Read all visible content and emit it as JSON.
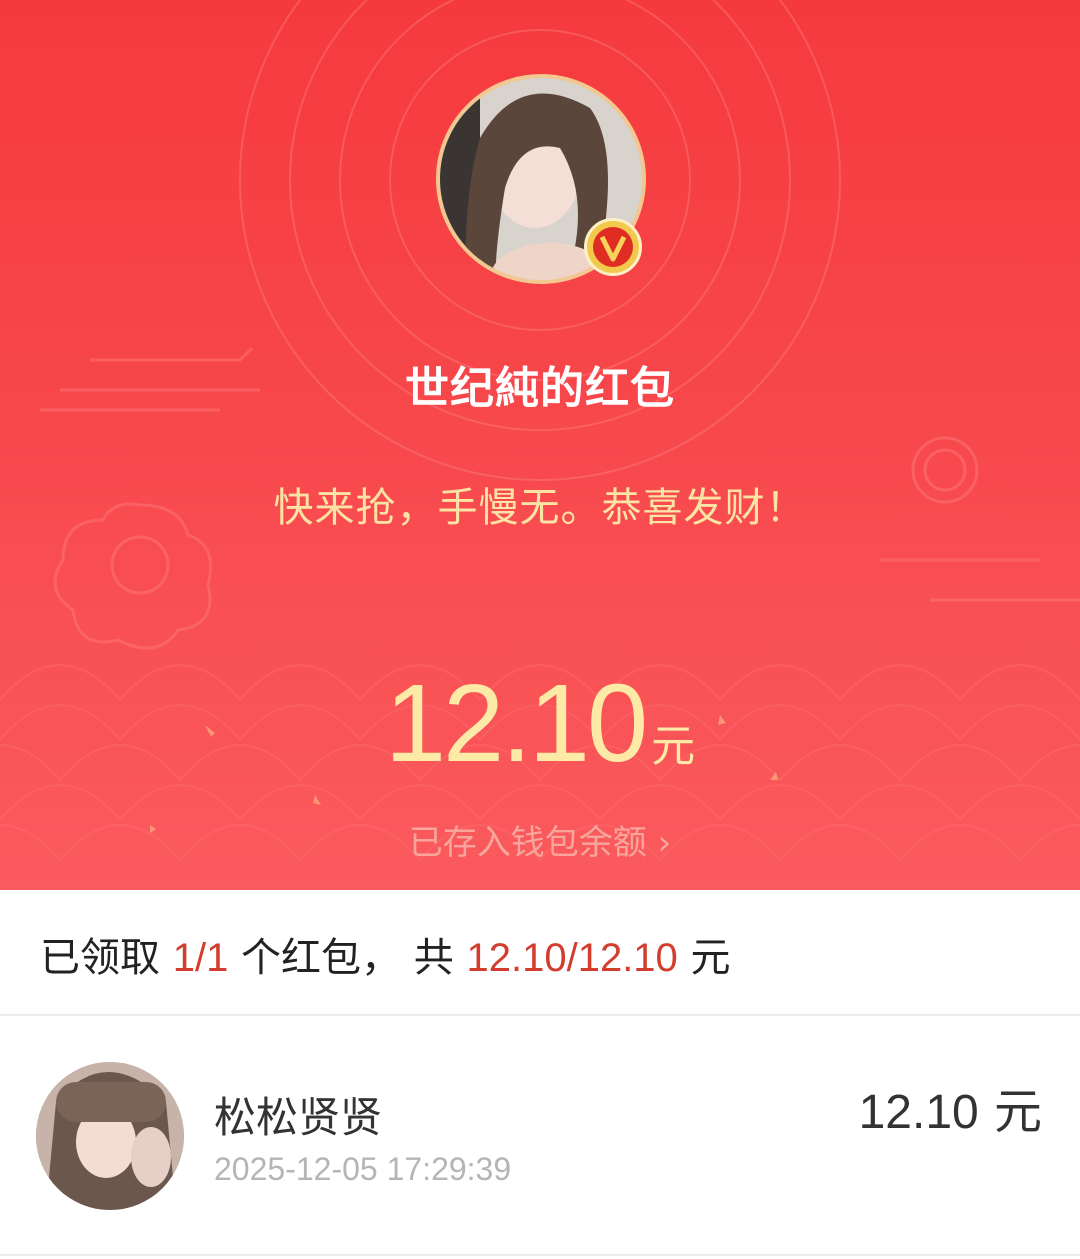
{
  "header": {
    "title": "世纪純的红包",
    "greeting": "快来抢，手慢无。恭喜发财！",
    "verified_icon": "v-badge-icon"
  },
  "amount": {
    "value": "12.10",
    "unit": "元"
  },
  "wallet_link": {
    "label": "已存入钱包余额",
    "chevron": "›"
  },
  "summary": {
    "prefix": "已领取 ",
    "claimed": "1/1",
    "middle": " 个红包， 共 ",
    "total": "12.10/12.10",
    "suffix": " 元"
  },
  "records": [
    {
      "name": "松松贤贤",
      "time": "2025-12-05 17:29:39",
      "amount": "12.10",
      "unit": "元"
    }
  ],
  "colors": {
    "hero_red": "#f7474b",
    "gold_text": "#fdeaa6",
    "highlight": "#d23d2e"
  }
}
